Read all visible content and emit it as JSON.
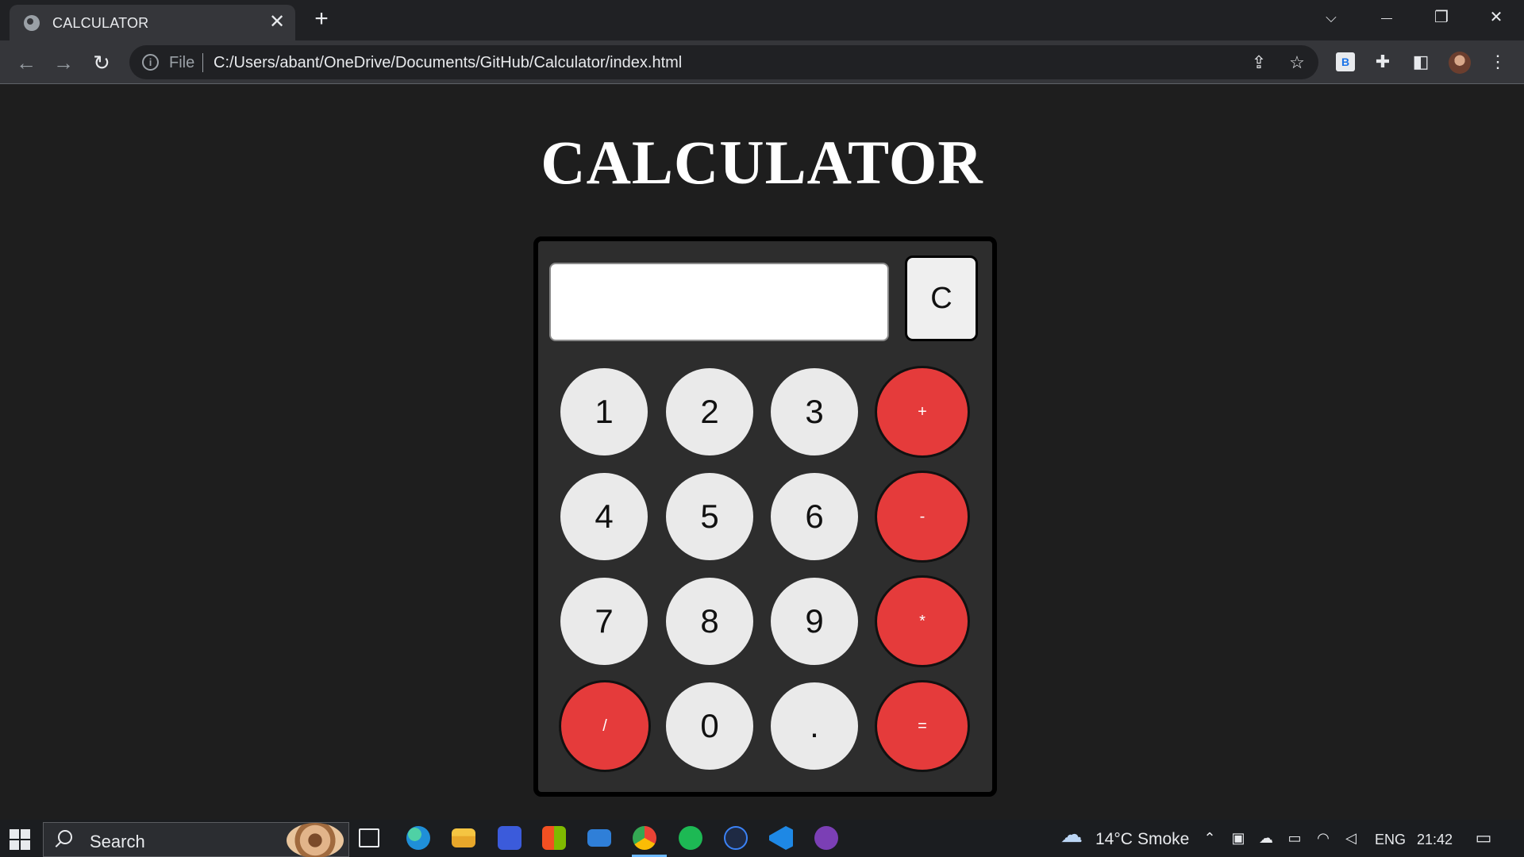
{
  "browser": {
    "tab_title": "CALCULATOR",
    "tab_close": "✕",
    "new_tab": "+",
    "address_scheme": "File",
    "address_url": "C:/Users/abant/OneDrive/Documents/GitHub/Calculator/index.html",
    "window_controls": {
      "tab_search": "⌵",
      "minimize": "—",
      "restore": "❐",
      "close": "✕"
    }
  },
  "page": {
    "title": "CALCULATOR"
  },
  "calculator": {
    "display_value": "",
    "clear_label": "C",
    "keys": {
      "k1": "1",
      "k2": "2",
      "k3": "3",
      "plus": "+",
      "k4": "4",
      "k5": "5",
      "k6": "6",
      "minus": "-",
      "k7": "7",
      "k8": "8",
      "k9": "9",
      "multiply": "*",
      "divide": "/",
      "k0": "0",
      "dot": ".",
      "equals": "="
    }
  },
  "taskbar": {
    "search_label": "Search",
    "weather": "14°C",
    "weather_condition": "Smoke",
    "language": "ENG",
    "time": "21:42"
  },
  "colors": {
    "page_bg": "#1e1e1e",
    "calc_bg": "#2d2d2d",
    "digit_key": "#eaeaea",
    "operator_key": "#e53b3b"
  }
}
